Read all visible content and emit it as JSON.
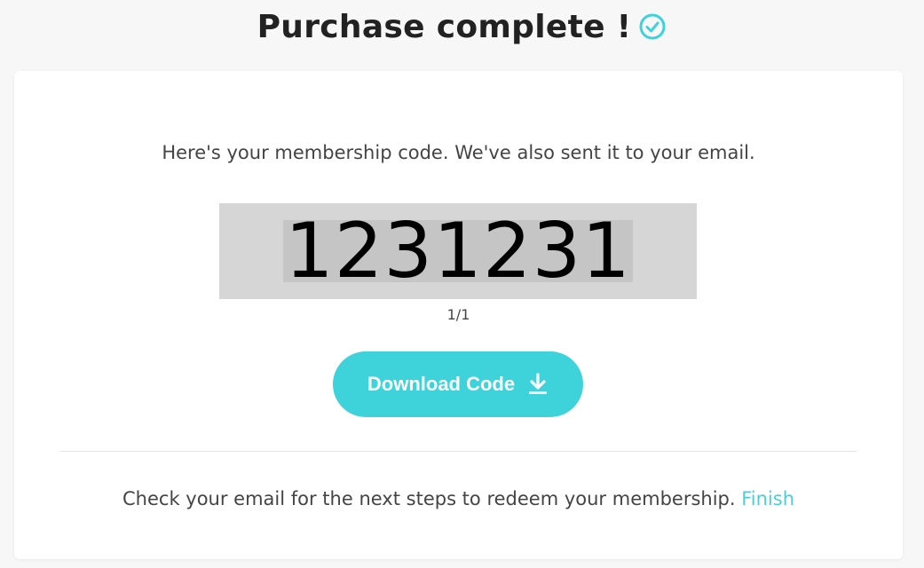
{
  "header": {
    "title": "Purchase complete !",
    "icon": "check-circle-icon",
    "icon_color": "#3ed2db"
  },
  "card": {
    "intro_text": "Here's your membership code. We've also sent it to your email.",
    "code": "1231231",
    "page_counter": "1/1",
    "download_button_label": "Download Code",
    "download_icon": "download-icon",
    "footer_text": "Check your email for the next steps to redeem your membership.",
    "finish_link_label": "Finish"
  },
  "colors": {
    "accent": "#3ed2db",
    "link": "#4fcdd6",
    "code_box_bg": "#d6d6d6",
    "code_highlight_bg": "#c5c5c5",
    "page_bg": "#f7f7f7",
    "card_bg": "#ffffff"
  }
}
